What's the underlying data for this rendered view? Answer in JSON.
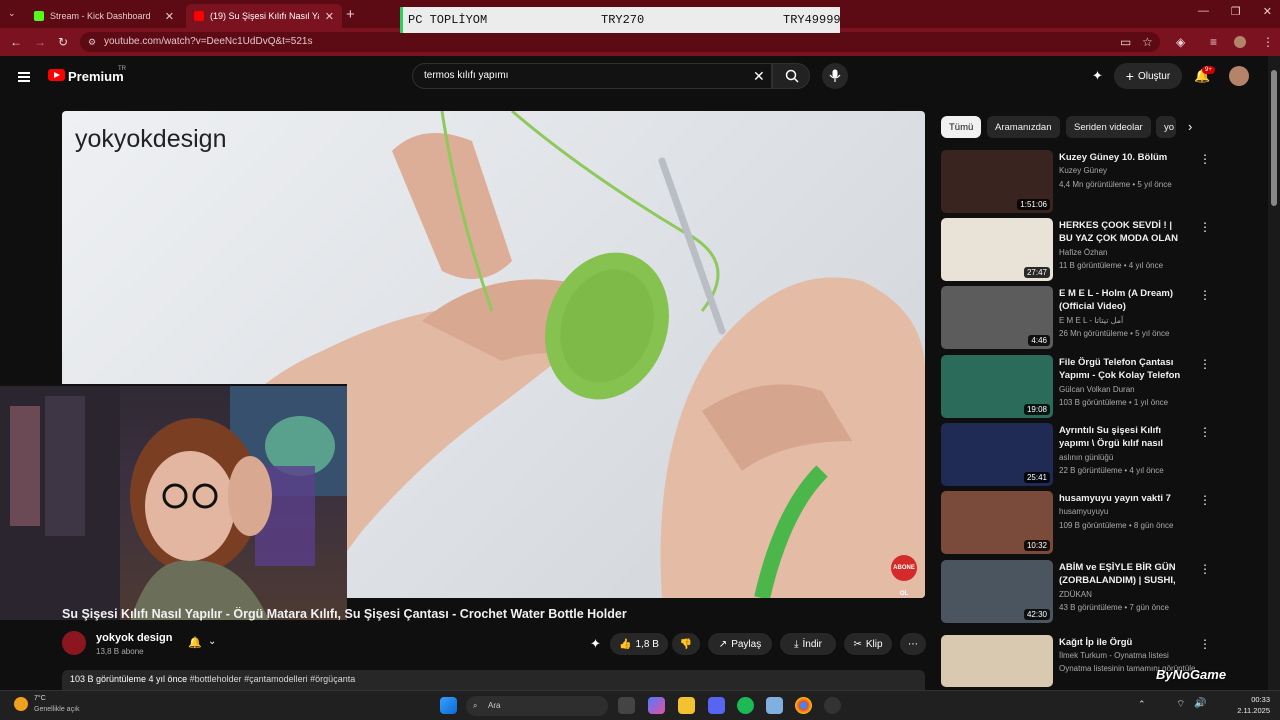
{
  "browser": {
    "tabs": [
      {
        "label": "Stream - Kick Dashboard",
        "close": "✕"
      },
      {
        "label": "(19) Su Şişesi Kılıfı Nasıl Yapılır - ",
        "close": "✕"
      }
    ],
    "new_tab": "+",
    "url": "youtube.com/watch?v=DeeNc1UdDvQ&t=521s",
    "window_controls": [
      "—",
      "❐",
      "✕"
    ]
  },
  "banner": {
    "label": "PC TOPLİYOM",
    "current": "TRY270",
    "goal": "TRY49999"
  },
  "youtube": {
    "logo_text": "Premium",
    "region": "TR",
    "search_value": "termos kılıfı yapımı",
    "create_label": "Oluştur",
    "notif_count": "9+"
  },
  "video": {
    "watermark": "yokyokdesign",
    "abone_badge": "ABONE OL",
    "title": "Su Şişesi Kılıfı Nasıl Yapılır - Örgü Matara Kılıfı, Su Şişesi Çantası - Crochet Water Bottle Holder",
    "channel": "yokyok design",
    "subs": "13,8 B abone",
    "likes": "1,8 B",
    "share": "Paylaş",
    "download": "İndir",
    "clip": "Klip",
    "more": "⋯",
    "desc_meta": "103 B görüntüleme  4 yıl önce",
    "desc_tags": " #bottleholder #çantamodelleri #örgüçanta"
  },
  "chips": [
    "Tümü",
    "Aramanızdan",
    "Seriden videolar",
    "yo"
  ],
  "recommendations": [
    {
      "title": "Kuzey Güney 10. Bölüm",
      "channel": "Kuzey Güney",
      "meta": "4,4 Mn görüntüleme • 5 yıl önce",
      "duration": "1:51:06",
      "color": "#3a2420"
    },
    {
      "title": "HERKES ÇOOK SEVDİ ! | BU YAZ ÇOK MODA OLAN SU ŞİŞESİ ...",
      "channel": "Hafize Özhan",
      "meta": "11 B görüntüleme • 4 yıl önce",
      "duration": "27:47",
      "color": "#e9e2d6"
    },
    {
      "title": "E M E L - Holm (A Dream) (Official Video)",
      "channel": "E M E L - آمل تیتاتا",
      "meta": "26 Mn görüntüleme • 5 yıl önce",
      "duration": "4:46",
      "color": "#5c5c5c"
    },
    {
      "title": "File Örgü Telefon Çantası Yapımı - Çok Kolay Telefon ...",
      "channel": "Gülcan Volkan Duran",
      "meta": "103 B görüntüleme • 1 yıl önce",
      "duration": "19:08",
      "color": "#2a6b5a"
    },
    {
      "title": "Ayrıntılı Su şişesi Kılıfı yapımı \\ Örgü kılıf nasıl yapılır",
      "channel": "aslının günlüğü",
      "meta": "22 B görüntüleme • 4 yıl önce",
      "duration": "25:41",
      "color": "#1f2a55"
    },
    {
      "title": "husamyuyu yayın vakti 7",
      "channel": "husamyuyuyu",
      "meta": "109 B görüntüleme • 8 gün önce",
      "duration": "10:32",
      "color": "#7a4a3a"
    },
    {
      "title": "ABİM ve EŞİYLE BİR GÜN (ZORBALANDIM) | SUSHI, ...",
      "channel": "ZDÜKAN",
      "meta": "43 B görüntüleme • 7 gün önce",
      "duration": "42:30",
      "color": "#4b5560"
    },
    {
      "title": "Kağıt İp ile Örgü",
      "channel": "İlmek Turkum - Oynatma listesi",
      "meta": "Oynatma listesinin tamamını görüntüle",
      "duration": "",
      "color": "#d9c9b0"
    }
  ],
  "overlay_brand": "ByNoGame",
  "taskbar": {
    "weather_temp": "7°C",
    "weather_desc": "Genellikle açık",
    "search_label": "Ara",
    "time": "00:33",
    "date": "2.11.2025"
  }
}
